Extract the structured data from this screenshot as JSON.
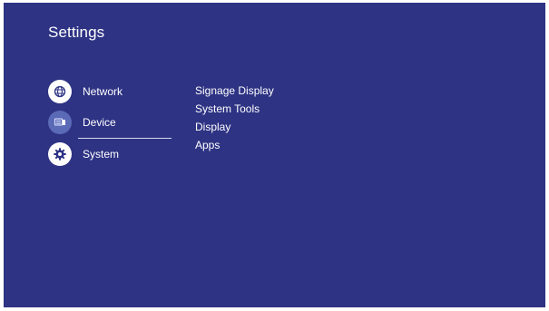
{
  "header": {
    "title": "Settings"
  },
  "sidebar": {
    "items": [
      {
        "label": "Network",
        "icon": "globe-icon"
      },
      {
        "label": "Device",
        "icon": "device-icon",
        "selected": true
      },
      {
        "label": "System",
        "icon": "gear-icon"
      }
    ]
  },
  "submenu": {
    "items": [
      {
        "label": "Signage Display"
      },
      {
        "label": "System Tools"
      },
      {
        "label": "Display"
      },
      {
        "label": "Apps"
      }
    ]
  },
  "colors": {
    "background": "#2e3384",
    "selected_icon": "#5b6ab7",
    "text": "#ffffff"
  }
}
